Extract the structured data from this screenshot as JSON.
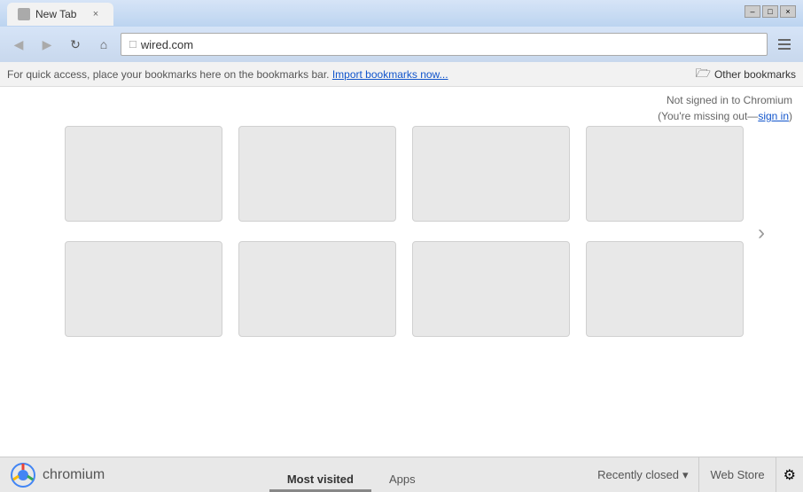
{
  "titlebar": {
    "tab_title": "New Tab",
    "close_label": "×",
    "minimize_label": "–",
    "maximize_label": "□",
    "closewin_label": "×"
  },
  "navbar": {
    "back_icon": "◀",
    "forward_icon": "▶",
    "reload_icon": "↻",
    "home_icon": "⌂",
    "address": "wired.com",
    "address_placeholder": "wired.com",
    "settings_icon": "☰"
  },
  "bookmarks_bar": {
    "message": "For quick access, place your bookmarks here on the bookmarks bar. ",
    "import_link": "Import bookmarks now...",
    "other_bookmarks": "Other bookmarks",
    "folder_icon": "📁"
  },
  "signin": {
    "line1": "Not signed in to Chromium",
    "line2_prefix": "(You're missing out—",
    "sign_in_link": "sign in",
    "line2_suffix": ")"
  },
  "thumbnails": {
    "arrow": "›",
    "items": [
      {
        "label": ""
      },
      {
        "label": ""
      },
      {
        "label": ""
      },
      {
        "label": ""
      },
      {
        "label": ""
      },
      {
        "label": ""
      },
      {
        "label": ""
      },
      {
        "label": ""
      }
    ]
  },
  "bottom_bar": {
    "logo_text": "chromium",
    "tabs": [
      {
        "id": "most-visited",
        "label": "Most visited",
        "active": true
      },
      {
        "id": "apps",
        "label": "Apps",
        "active": false
      }
    ],
    "recently_closed": "Recently closed",
    "dropdown_icon": "▾",
    "web_store": "Web Store",
    "gear_icon": "⚙"
  }
}
